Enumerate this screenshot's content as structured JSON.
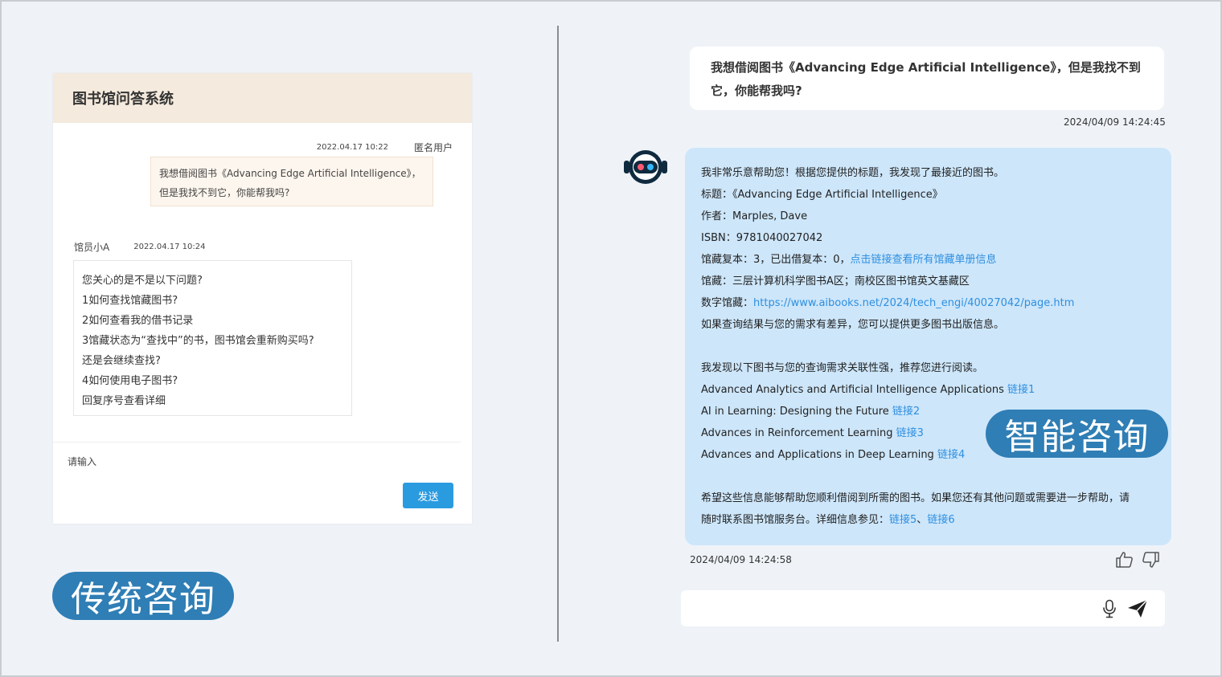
{
  "traditional": {
    "title": "图书馆问答系统",
    "user_time": "2022.04.17  10:22",
    "user_name": "匿名用户",
    "user_message": "我想借阅图书《Advancing Edge Artificial Intelligence》，但是我找不到它，你能帮我吗?",
    "staff_name": "馆员小A",
    "staff_time": "2022.04.17  10:24",
    "staff_lines": [
      "您关心的是不是以下问题?",
      "1如何查找馆藏图书?",
      "2如何查看我的借书记录",
      "3馆藏状态为“查找中”的书，图书馆会重新购买吗?",
      "还是会继续查找?",
      "4如何使用电子图书?",
      "回复序号查看详细"
    ],
    "input_placeholder": "请输入",
    "send_label": "发送",
    "pill_label": "传统咨询"
  },
  "smart": {
    "question": "我想借阅图书《Advancing Edge Artificial Intelligence》，但是我找不到它，你能帮我吗?",
    "question_time": "2024/04/09 14:24:45",
    "answer": {
      "intro": "我非常乐意帮助您！根据您提供的标题，我发现了最接近的图书。",
      "title_line": "标题：《Advancing Edge Artificial Intelligence》",
      "author_line": "作者：Marples, Dave",
      "isbn_line": "ISBN：9781040027042",
      "copies_text": "馆藏复本：3，已出借复本：0，",
      "copies_link": "点击链接查看所有馆藏单册信息",
      "location_line": "馆藏：三层计算机科学图书A区；南校区图书馆英文基藏区",
      "digital_label": "数字馆藏：",
      "digital_url": "https://www.aibooks.net/2024/tech_engi/40027042/page.htm",
      "more_info": "如果查询结果与您的需求有差异，您可以提供更多图书出版信息。",
      "rec_intro": "我发现以下图书与您的查询需求关联性强，推荐您进行阅读。",
      "recommendations": [
        {
          "title": "Advanced Analytics and Artificial Intelligence Applications",
          "link": "链接1"
        },
        {
          "title": "AI in Learning: Designing the Future",
          "link": "链接2"
        },
        {
          "title": "Advances in Reinforcement Learning",
          "link": "链接3"
        },
        {
          "title": "Advances and Applications in Deep Learning",
          "link": "链接4"
        }
      ],
      "closing_1": "希望这些信息能够帮助您顺利借阅到所需的图书。如果您还有其他问题或需要进一步帮助，请",
      "closing_2": "随时联系图书馆服务台。详细信息参见：",
      "link5": "链接5",
      "sep": "、",
      "link6": "链接6"
    },
    "answer_time": "2024/04/09 14:24:58",
    "pill_label": "智能咨询",
    "icons": [
      "robot-avatar-icon",
      "thumbs-up-icon",
      "thumbs-down-icon",
      "microphone-icon",
      "send-icon"
    ]
  },
  "colors": {
    "header_bg": "#f4eadd",
    "send_button": "#2b9be0",
    "pill": "#2f7eb5",
    "answer_bg": "#cde6fa",
    "link": "#2e8fe0"
  }
}
